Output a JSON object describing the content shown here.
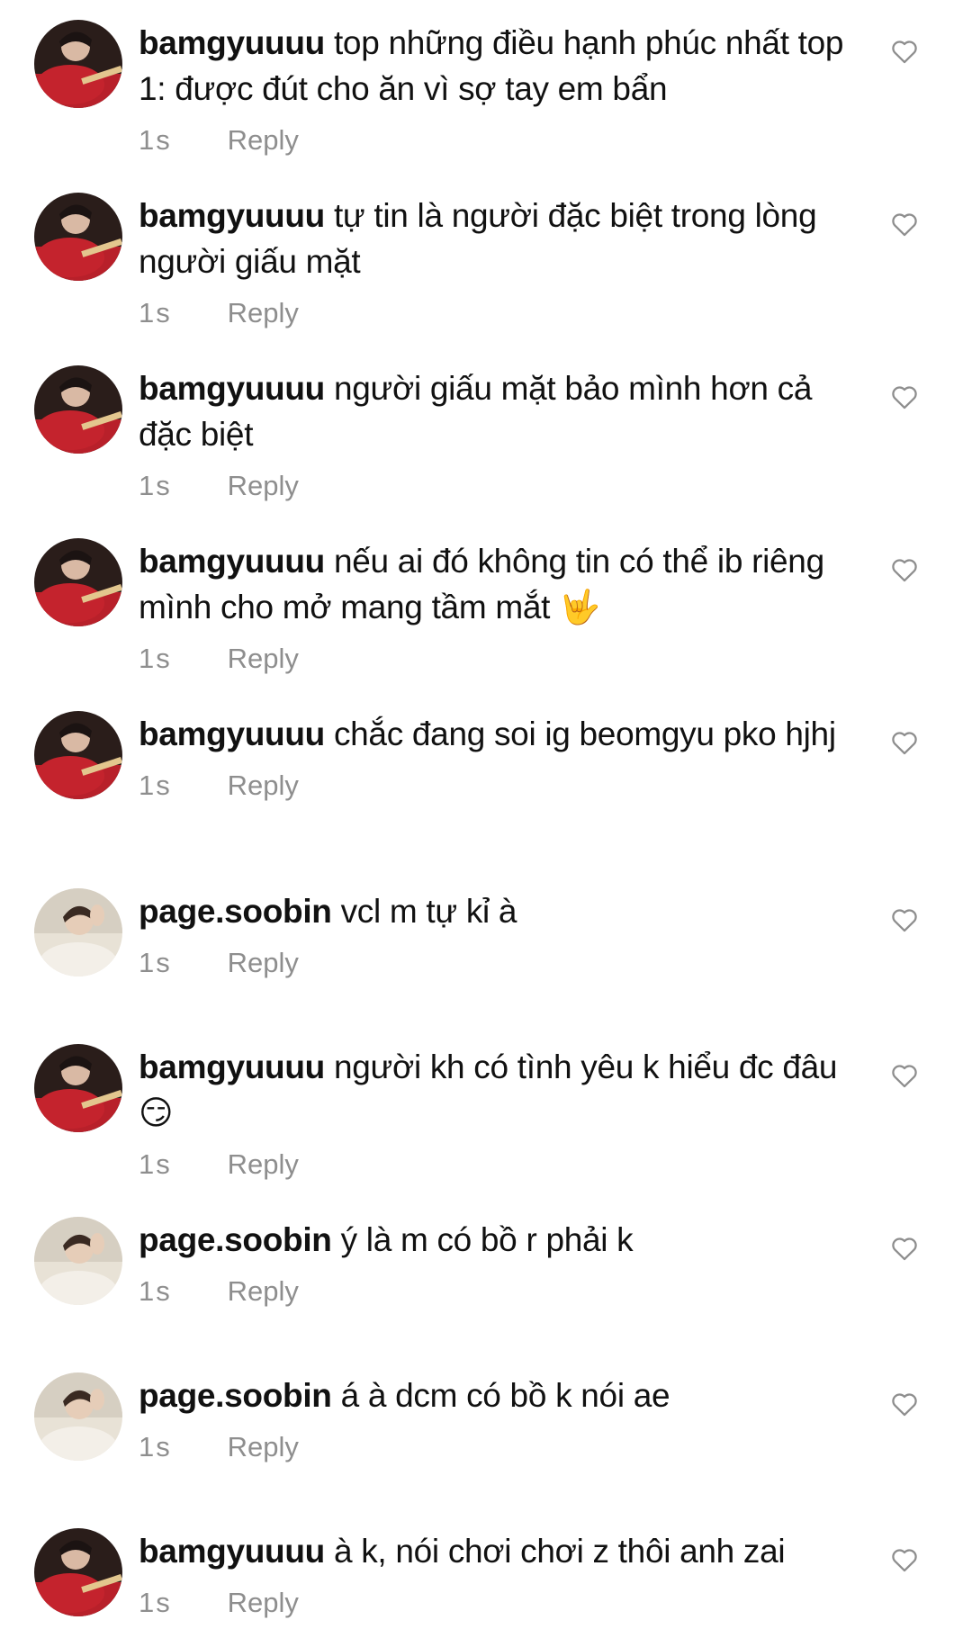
{
  "reply_label": "Reply",
  "comments": [
    {
      "user": "bamgyuuuu",
      "text": "top những điều hạnh phúc nhất top 1: được đút cho ăn vì sợ tay em bẩn",
      "time": "1s"
    },
    {
      "user": "bamgyuuuu",
      "text": "tự tin là người đặc biệt trong lòng người giấu mặt",
      "time": "1s"
    },
    {
      "user": "bamgyuuuu",
      "text": "người giấu mặt bảo mình hơn cả đặc biệt",
      "time": "1s"
    },
    {
      "user": "bamgyuuuu",
      "text": "nếu ai đó không tin có thể ib riêng mình cho mở mang tầm mắt 🤟",
      "time": "1s"
    },
    {
      "user": "bamgyuuuu",
      "text": "chắc đang soi ig beomgyu pko hjhj",
      "time": "1s"
    },
    {
      "user": "page.soobin",
      "text": "vcl m tự kỉ à",
      "time": "1s"
    },
    {
      "user": "bamgyuuuu",
      "text": "người kh có tình yêu k hiểu đc đâu 😏",
      "time": "1s"
    },
    {
      "user": "page.soobin",
      "text": "ý là m có bồ r phải k",
      "time": "1s"
    },
    {
      "user": "page.soobin",
      "text": "á à dcm có bồ k nói ae",
      "time": "1s"
    },
    {
      "user": "bamgyuuuu",
      "text": "à k, nói chơi chơi z thôi anh zai",
      "time": "1s"
    }
  ],
  "colors": {
    "text": "#111111",
    "meta": "#8e8e8e",
    "avatar_bamgyuuuu": "#b8202a",
    "avatar_soobin": "#e8e2d6"
  }
}
